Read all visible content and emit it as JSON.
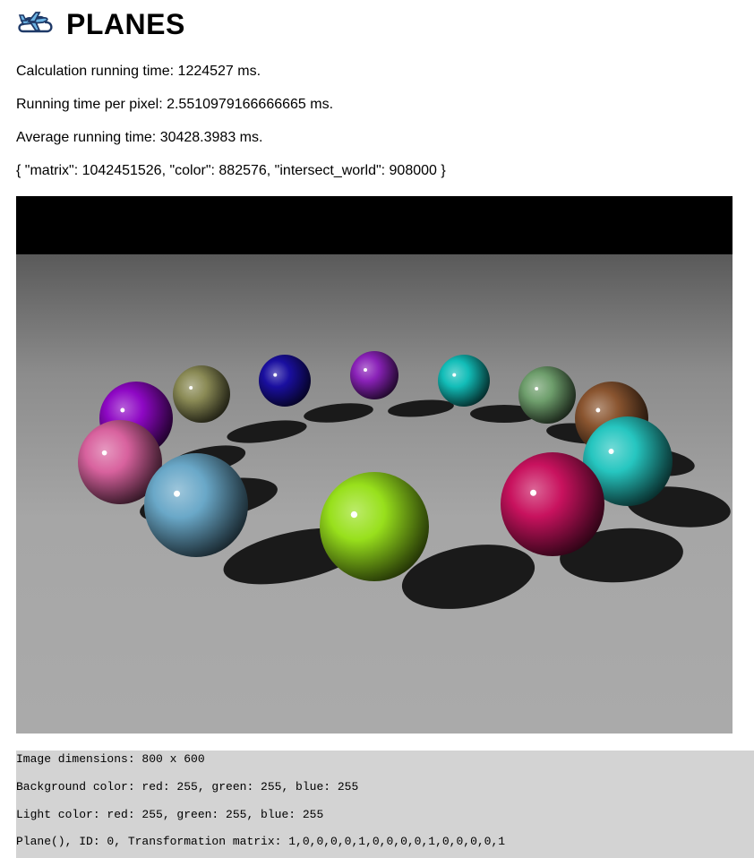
{
  "header": {
    "title": "PLANES",
    "logo_icon": "airplane-cloud-icon"
  },
  "stats": {
    "calc_time": "Calculation running time: 1224527 ms.",
    "time_per_pixel": "Running time per pixel: 2.5510979166666665 ms.",
    "average_time": "Average running time: 30428.3983 ms.",
    "counters": "{ \"matrix\": 1042451526, \"color\": 882576, \"intersect_world\": 908000 }"
  },
  "render": {
    "sky_color": "#000000",
    "floor_far_color": "#5a5a5a",
    "floor_near_color": "#a9a9a9",
    "shadow_color": "#1a1a1a",
    "spheres": [
      {
        "name": "sphere-purple-far-left",
        "color": "#8e08c4"
      },
      {
        "name": "sphere-olive",
        "color": "#8a8a55"
      },
      {
        "name": "sphere-navy",
        "color": "#1a0fa0"
      },
      {
        "name": "sphere-violet",
        "color": "#8a22b8"
      },
      {
        "name": "sphere-teal-back",
        "color": "#12bdb8"
      },
      {
        "name": "sphere-sage",
        "color": "#6e9e6c"
      },
      {
        "name": "sphere-brown",
        "color": "#8a5530"
      },
      {
        "name": "sphere-pink",
        "color": "#d8629e"
      },
      {
        "name": "sphere-cyan-right",
        "color": "#26c6c0"
      },
      {
        "name": "sphere-steel-blue",
        "color": "#6aa8c8"
      },
      {
        "name": "sphere-magenta",
        "color": "#c8125e"
      },
      {
        "name": "sphere-lime",
        "color": "#98e01c"
      }
    ]
  },
  "info": {
    "dimensions": "Image dimensions: 800 x 600",
    "background": "Background color: red: 255, green: 255, blue: 255",
    "light": "Light color: red: 255, green: 255, blue: 255",
    "plane": "Plane(), ID: 0, Transformation matrix: 1,0,0,0,0,1,0,0,0,0,1,0,0,0,0,1"
  }
}
